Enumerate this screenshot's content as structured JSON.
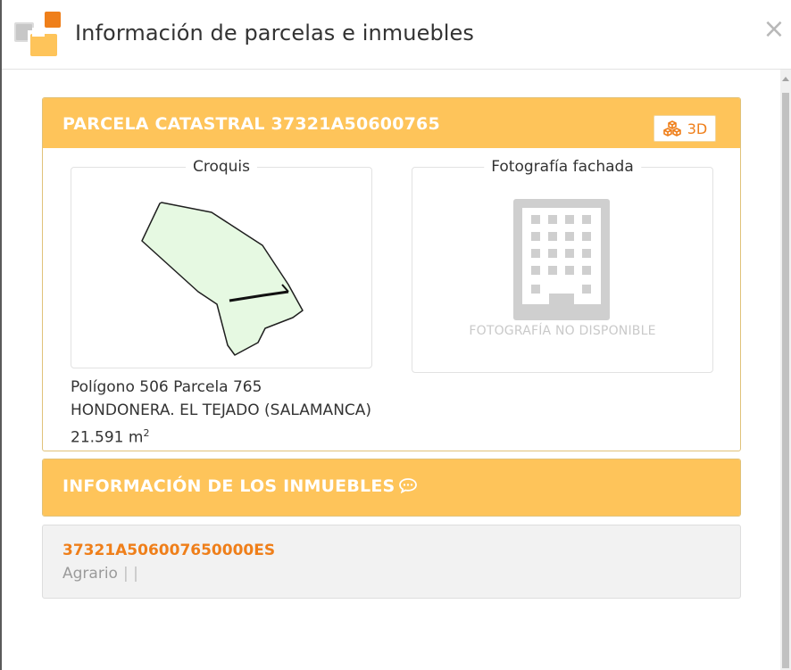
{
  "dialog": {
    "title": "Información de parcelas e inmuebles",
    "close_glyph": "×"
  },
  "parcel": {
    "header": "PARCELA CATASTRAL 37321A50600765",
    "button_3d": "3D",
    "sketch_label": "Croquis",
    "photo_label": "Fotografía fachada",
    "no_photo_text": "FOTOGRAFÍA NO DISPONIBLE",
    "location_line": "Polígono 506 Parcela 765",
    "municipality_line": "HONDONERA. EL TEJADO (SALAMANCA)",
    "area_value": "21.591 m",
    "area_unit_exp": "2"
  },
  "properties_section": {
    "header": "INFORMACIÓN DE LOS INMUEBLES"
  },
  "property": {
    "reference": "37321A506007650000ES",
    "use": "Agrario",
    "separators": "| |"
  },
  "colors": {
    "header_orange": "#fec45a",
    "accent_orange": "#ef7f1a",
    "parcel_fill": "#e6f9e2"
  },
  "icons": {
    "logo": "catastro-logo-icon",
    "close": "close-icon",
    "button_3d": "cubes-icon",
    "comment": "comment-icon",
    "no_photo": "building-icon"
  }
}
